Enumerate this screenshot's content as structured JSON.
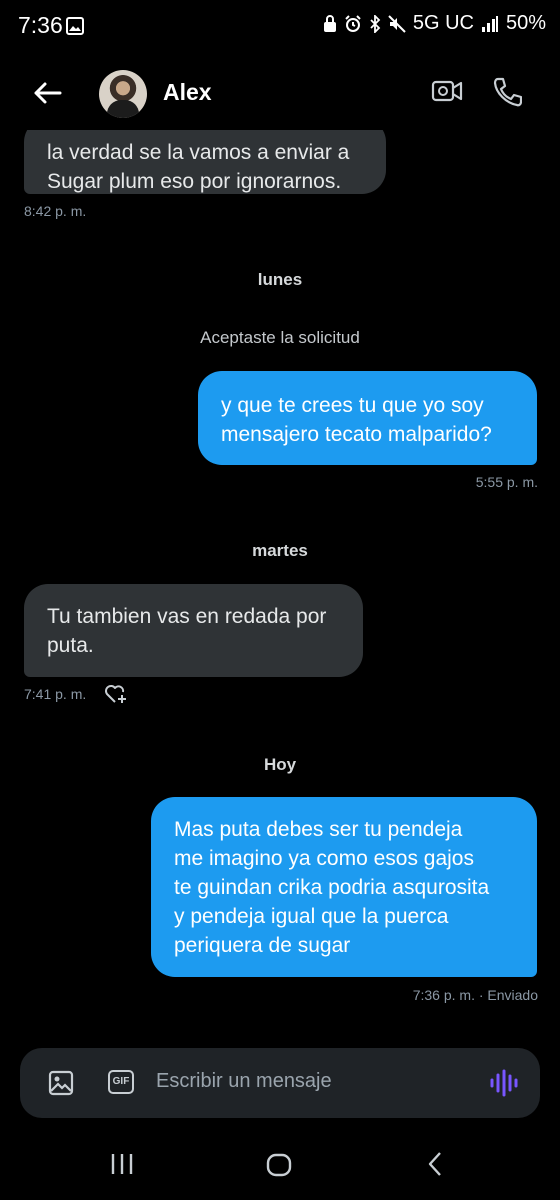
{
  "status_bar": {
    "time": "7:36",
    "network": "5G UC",
    "battery": "50%"
  },
  "header": {
    "contact_name": "Alex"
  },
  "messages": [
    {
      "direction": "in",
      "lines": [
        "la verdad se la vamos a enviar a",
        "Sugar plum eso por ignorarnos."
      ],
      "time": "8:42 p. m."
    },
    {
      "direction": "out",
      "lines": [
        "y que te crees tu que yo soy",
        "mensajero tecato malparido?"
      ],
      "time": "5:55 p. m."
    },
    {
      "direction": "in",
      "lines": [
        "Tu tambien vas en redada por",
        "puta."
      ],
      "time": "7:41 p. m."
    },
    {
      "direction": "out",
      "lines": [
        "Mas puta debes ser tu pendeja",
        "me imagino ya como esos gajos",
        "te guindan crika podria asqurosita",
        "y pendeja igual que la puerca",
        "periquera de sugar"
      ],
      "time": "7:36 p. m. · Enviado"
    }
  ],
  "separators": {
    "monday": "lunes",
    "tuesday": "martes",
    "today": "Hoy"
  },
  "system_message": "Aceptaste la solicitud",
  "composer": {
    "placeholder": "Escribir un mensaje",
    "gif_label": "GIF"
  },
  "colors": {
    "outgoing_bubble": "#1d9bf0",
    "incoming_bubble": "#2f3336",
    "voice_accent": "#7856ff",
    "background": "#000000"
  }
}
